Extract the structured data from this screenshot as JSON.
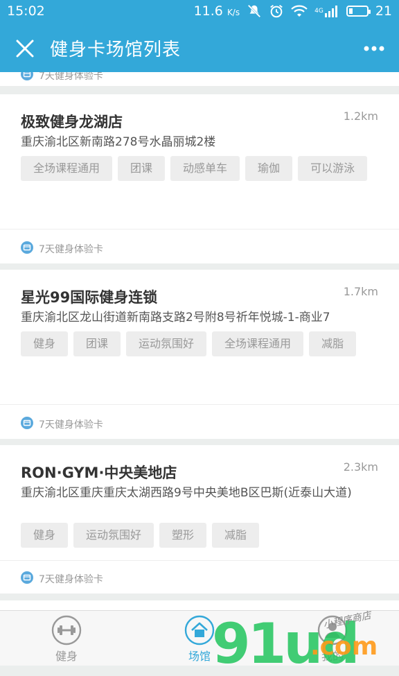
{
  "status": {
    "time": "15:02",
    "speed": "11.6",
    "speed_unit": "K/s",
    "network": "4G",
    "battery": "21",
    "battery_level": 0.21
  },
  "header": {
    "title": "健身卡场馆列表"
  },
  "peek": {
    "trial_text": "7天健身体验卡"
  },
  "venues": [
    {
      "name": "极致健身龙湖店",
      "distance": "1.2km",
      "address": "重庆渝北区新南路278号水晶丽城2楼",
      "tags": [
        "全场课程通用",
        "团课",
        "动感单车",
        "瑜伽",
        "可以游泳"
      ],
      "trial": "7天健身体验卡"
    },
    {
      "name": "星光99国际健身连锁",
      "distance": "1.7km",
      "address": "重庆渝北区龙山街道新南路支路2号附8号祈年悦城-1-商业7",
      "tags": [
        "健身",
        "团课",
        "运动氛围好",
        "全场课程通用",
        "减脂"
      ],
      "trial": "7天健身体验卡"
    },
    {
      "name": "RON·GYM·中央美地店",
      "distance": "2.3km",
      "address": "重庆渝北区重庆重庆太湖西路9号中央美地B区巴斯(近泰山大道)",
      "tags": [
        "健身",
        "运动氛围好",
        "塑形",
        "减脂"
      ],
      "trial": "7天健身体验卡"
    }
  ],
  "tabs": [
    {
      "label": "健身",
      "icon": "dumbbell-icon",
      "active": false
    },
    {
      "label": "场馆",
      "icon": "home-icon",
      "active": true
    },
    {
      "label": "我的",
      "icon": "user-icon",
      "active": false
    }
  ],
  "colors": {
    "primary": "#33a8d9",
    "tab_inactive": "#999999",
    "tab_active": "#33a8d9"
  },
  "watermark": {
    "main": "91ud",
    "suffix": ".com",
    "small": "小程序商店"
  }
}
